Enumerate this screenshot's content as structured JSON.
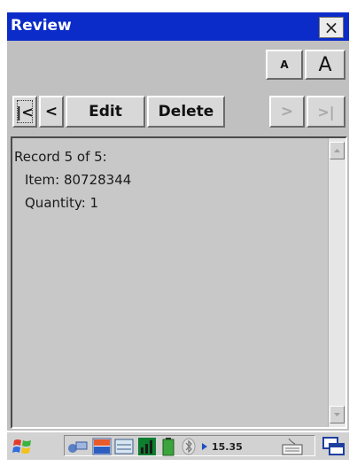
{
  "window": {
    "title": "Review",
    "close_label": "×"
  },
  "font_controls": {
    "small_label": "A",
    "large_label": "A"
  },
  "nav": {
    "first_label": "|<",
    "prev_label": "<",
    "edit_label": "Edit",
    "delete_label": "Delete",
    "next_label": ">",
    "last_label": ">|"
  },
  "record": {
    "header": "Record 5 of 5:",
    "item": "Item: 80728344",
    "quantity": "Quantity: 1"
  },
  "taskbar": {
    "clock": "15.35",
    "start_icon": "windows-flag-icon",
    "tray_icons": [
      "network-icon",
      "ime-icon",
      "keypad-icon",
      "signal-icon",
      "battery-icon",
      "bluetooth-icon",
      "keyboard-icon",
      "task-switch-icon"
    ]
  },
  "colors": {
    "titlebar": "#0b2cc8",
    "background": "#c0c0c0"
  }
}
